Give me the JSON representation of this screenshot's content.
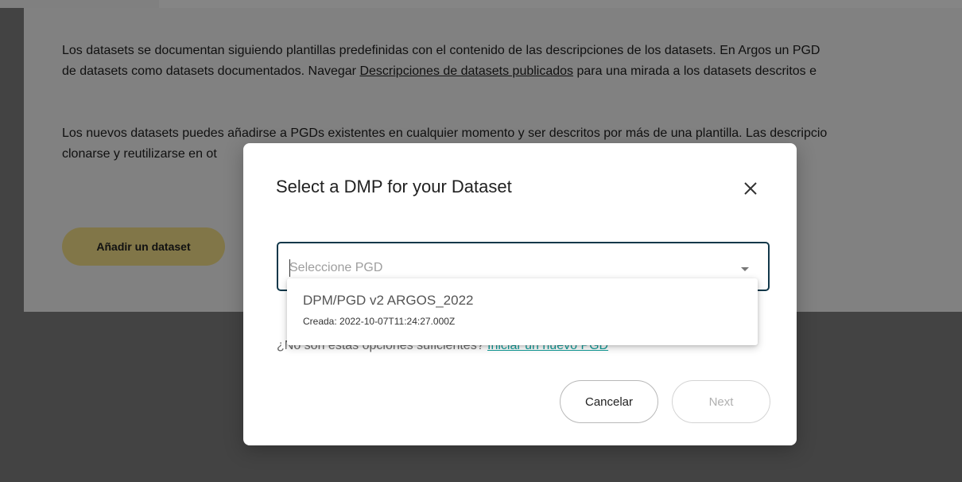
{
  "background": {
    "paragraph1_text": "Los datasets se documentan siguiendo plantillas predefinidas con el contenido de las descripciones de los datasets. En Argos un PGD",
    "paragraph1_line2_before": "de datasets como datasets documentados. Navegar ",
    "paragraph1_link": "Descripciones de datasets publicados",
    "paragraph1_line2_after": " para una mirada a los datasets descritos e",
    "paragraph2_line1": "Los nuevos datasets puedes añadirse a PGDs existentes en cualquier momento y ser descritos por más de una plantilla. Las descripcio",
    "paragraph2_line2": "clonarse y reutilizarse en ot",
    "add_dataset_label": "Añadir un dataset"
  },
  "dialog": {
    "title": "Select a DMP for your Dataset",
    "close_icon": "close-icon",
    "select_placeholder": "Seleccione PGD",
    "options": [
      {
        "title": "DPM/PGD v2 ARGOS_2022",
        "created": "Creada: 2022-10-07T11:24:27.000Z"
      }
    ],
    "hint_text": "¿No son estas opciones suficientes? ",
    "hint_link": "Iniciar un nuevo PGD",
    "cancel_label": "Cancelar",
    "next_label": "Next"
  },
  "colors": {
    "accent_border": "#12384a",
    "link": "#129d99",
    "add_button": "#f7e38a"
  }
}
